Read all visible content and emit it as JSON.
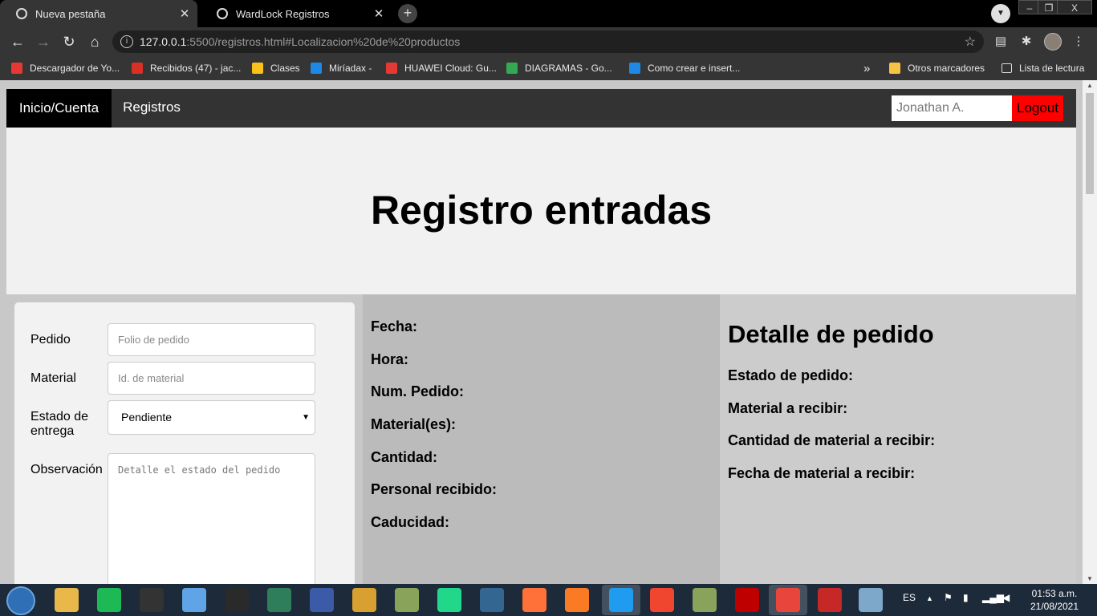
{
  "browser": {
    "tabs": [
      {
        "title": "Nueva pestaña",
        "active": false
      },
      {
        "title": "WardLock Registros",
        "active": true
      }
    ],
    "new_tab_label": "+",
    "url_host": "127.0.0.1",
    "url_rest": ":5500/registros.html#Localizacion%20de%20productos",
    "bookmarks": [
      {
        "label": "Descargador de Yo...",
        "color": "#e53935"
      },
      {
        "label": "Recibidos (47) - jac...",
        "color": "#d93025"
      },
      {
        "label": "Clases",
        "color": "#f9c21b"
      },
      {
        "label": "Miríadax -",
        "color": "#1e88e5"
      },
      {
        "label": "HUAWEI Cloud: Gu...",
        "color": "#e53935"
      },
      {
        "label": "DIAGRAMAS - Go...",
        "color": "#34a853"
      },
      {
        "label": "Como crear e insert...",
        "color": "#1e88e5"
      },
      {
        "label": "»",
        "color": ""
      },
      {
        "label": "Otros marcadores",
        "color": "#f6c344"
      },
      {
        "label": "Lista de lectura",
        "color": ""
      }
    ]
  },
  "page": {
    "nav": {
      "home": "Inicio/Cuenta",
      "records": "Registros",
      "user": "Jonathan A.",
      "logout": "Logout"
    },
    "hero_title": "Registro entradas",
    "form": {
      "pedido_label": "Pedido",
      "pedido_placeholder": "Folio de pedido",
      "material_label": "Material",
      "material_placeholder": "Id. de material",
      "estado_label": "Estado de entrega",
      "estado_value": "Pendiente",
      "observacion_label": "Observación",
      "observacion_placeholder": "Detalle el estado del pedido"
    },
    "summary_fields": [
      "Fecha:",
      "Hora:",
      "Num. Pedido:",
      "Material(es):",
      "Cantidad:",
      "Personal recibido:",
      "Caducidad:"
    ],
    "detail": {
      "title": "Detalle de pedido",
      "fields": [
        "Estado de pedido:",
        "Material a recibir:",
        "Cantidad de material a recibir:",
        "Fecha de material a recibir:"
      ]
    }
  },
  "taskbar": {
    "language": "ES",
    "time": "01:53 a.m.",
    "date": "21/08/2021",
    "apps": [
      {
        "name": "file-explorer",
        "color": "#e8b84a"
      },
      {
        "name": "spotify",
        "color": "#1db954"
      },
      {
        "name": "app-i",
        "color": "#333333"
      },
      {
        "name": "virtualbox-cube",
        "color": "#5ea4e6"
      },
      {
        "name": "obs",
        "color": "#2a2a2a"
      },
      {
        "name": "app-green",
        "color": "#2e7d5b"
      },
      {
        "name": "project",
        "color": "#3b5aa8"
      },
      {
        "name": "app-diamond",
        "color": "#d8a030"
      },
      {
        "name": "app-globe",
        "color": "#8aa35a"
      },
      {
        "name": "pycharm",
        "color": "#21d789"
      },
      {
        "name": "postgresql",
        "color": "#336791"
      },
      {
        "name": "firefox",
        "color": "#ff7139"
      },
      {
        "name": "xampp",
        "color": "#fb7a24"
      },
      {
        "name": "vscode",
        "color": "#1f9cf0"
      },
      {
        "name": "app-x",
        "color": "#f0452f"
      },
      {
        "name": "app-globe-2",
        "color": "#8aa35a"
      },
      {
        "name": "filezilla",
        "color": "#bf0000"
      },
      {
        "name": "chrome",
        "color": "#e8453c"
      },
      {
        "name": "app-z",
        "color": "#c62828"
      },
      {
        "name": "paint",
        "color": "#7da8c9"
      }
    ]
  }
}
